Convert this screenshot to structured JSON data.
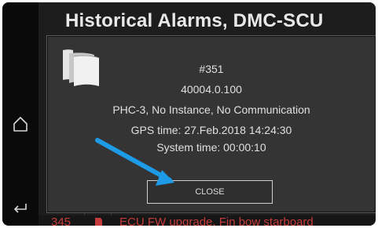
{
  "header": {
    "title": "Historical Alarms, DMC-SCU"
  },
  "sidebar": {
    "home_icon": "home-icon",
    "back_icon": "back-icon"
  },
  "alarm_list": {
    "partial_row": {
      "number": "345",
      "text": "ECU FW upgrade. Fin bow starboard",
      "color": "#c63b3b"
    }
  },
  "dialog": {
    "icon": "stacked-documents-icon",
    "alarm_number": "#351",
    "code": "40004.0.100",
    "description": "PHC-3, No Instance, No Communication",
    "gps_time": "GPS time: 27.Feb.2018 14:24:30",
    "system_time": "System time: 00:00:10",
    "close_label": "CLOSE"
  },
  "annotation": {
    "arrow_color": "#1d9be6"
  },
  "colors": {
    "screen_background": "#0b0b0b",
    "dialog_background": "#343434",
    "alarm_text": "#c63b3b"
  }
}
